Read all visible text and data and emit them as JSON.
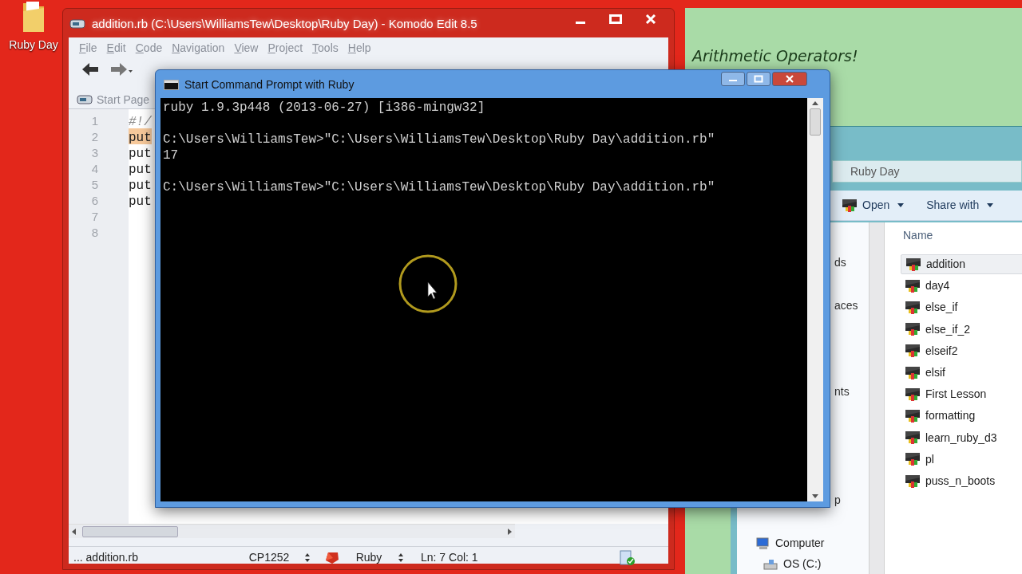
{
  "desktop": {
    "icons": [
      {
        "label": "Ruby Day"
      }
    ]
  },
  "editor": {
    "title": "addition.rb (C:\\Users\\WilliamsTew\\Desktop\\Ruby Day) - Komodo Edit 8.5",
    "menu": [
      {
        "label": "File"
      },
      {
        "label": "Edit"
      },
      {
        "label": "Code"
      },
      {
        "label": "Navigation"
      },
      {
        "label": "View"
      },
      {
        "label": "Project"
      },
      {
        "label": "Tools"
      },
      {
        "label": "Help"
      }
    ],
    "tabs": [
      {
        "label": "Start Page",
        "selected": false
      }
    ],
    "lines": [
      {
        "number": "1",
        "code": "#!/",
        "highlighted": false,
        "kind": "comment"
      },
      {
        "number": "2",
        "code": "put",
        "highlighted": true,
        "kind": "code"
      },
      {
        "number": "3",
        "code": "put",
        "highlighted": false,
        "kind": "code"
      },
      {
        "number": "4",
        "code": "put",
        "highlighted": false,
        "kind": "code"
      },
      {
        "number": "5",
        "code": "put",
        "highlighted": false,
        "kind": "code"
      },
      {
        "number": "6",
        "code": "put",
        "highlighted": false,
        "kind": "code"
      },
      {
        "number": "7",
        "highlighted": false,
        "kind": "empty"
      },
      {
        "number": "8",
        "highlighted": false,
        "kind": "empty"
      }
    ],
    "status_bar": {
      "file": "... addition.rb",
      "encoding": "CP1252",
      "language": "Ruby",
      "position": "Ln: 7 Col: 1"
    }
  },
  "slide": {
    "title": "Arithmetic Operators!"
  },
  "explorer": {
    "address": "Ruby Day",
    "toolbar": [
      {
        "label": "Open"
      },
      {
        "label": "Share with"
      }
    ],
    "nav": [
      {
        "label": "ds"
      },
      {
        "label": "aces"
      },
      {
        "label": "nts"
      },
      {
        "label": "p"
      }
    ],
    "drives": [
      {
        "label": "Computer",
        "kind": "computer"
      },
      {
        "label": "OS (C:)",
        "kind": "drive"
      }
    ],
    "column": "Name",
    "files": [
      {
        "label": "addition",
        "selected": true
      },
      {
        "label": "day4",
        "selected": false
      },
      {
        "label": "else_if",
        "selected": false
      },
      {
        "label": "else_if_2",
        "selected": false
      },
      {
        "label": "elseif2",
        "selected": false
      },
      {
        "label": "elsif",
        "selected": false
      },
      {
        "label": "First Lesson",
        "selected": false
      },
      {
        "label": "formatting",
        "selected": false
      },
      {
        "label": "learn_ruby_d3",
        "selected": false
      },
      {
        "label": "pl",
        "selected": false
      },
      {
        "label": "puss_n_boots",
        "selected": false
      }
    ]
  },
  "console": {
    "title": "Start Command Prompt with Ruby",
    "output": "ruby 1.9.3p448 (2013-06-27) [i386-mingw32]\n\nC:\\Users\\WilliamsTew>\"C:\\Users\\WilliamsTew\\Desktop\\Ruby Day\\addition.rb\"\n17\n\nC:\\Users\\WilliamsTew>\"C:\\Users\\WilliamsTew\\Desktop\\Ruby Day\\addition.rb\""
  }
}
